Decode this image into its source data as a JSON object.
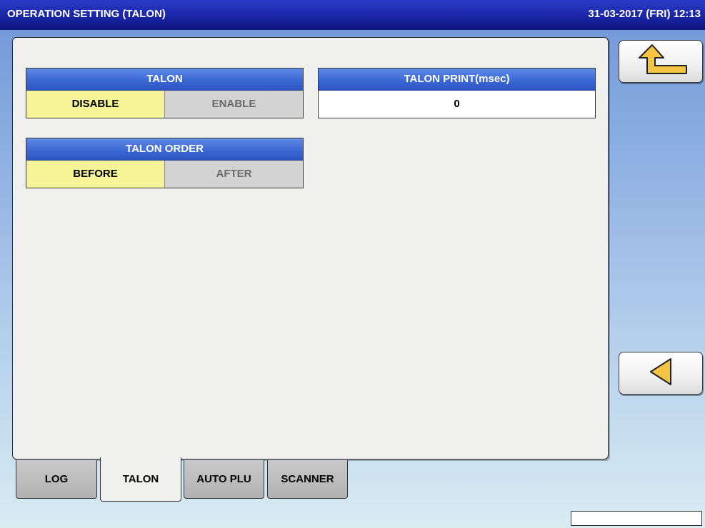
{
  "header": {
    "title": "OPERATION SETTING (TALON)",
    "datetime": "31-03-2017 (FRI)  12:13"
  },
  "talon": {
    "label": "TALON",
    "options": [
      "DISABLE",
      "ENABLE"
    ],
    "selected": "DISABLE"
  },
  "talon_print": {
    "label": "TALON PRINT(msec)",
    "value": "0"
  },
  "talon_order": {
    "label": "TALON ORDER",
    "options": [
      "BEFORE",
      "AFTER"
    ],
    "selected": "BEFORE"
  },
  "tabs": [
    "LOG",
    "TALON",
    "AUTO PLU",
    "SCANNER"
  ],
  "active_tab": "TALON",
  "side_buttons": {
    "return_icon": "return-arrow-icon",
    "back_icon": "left-triangle-icon"
  },
  "colors": {
    "title_bar": "#1a26a6",
    "group_header": "#3a66d4",
    "selected_option": "#f5f597",
    "unselected_option": "#d3d3d3",
    "icon_fill": "#f5c542"
  }
}
